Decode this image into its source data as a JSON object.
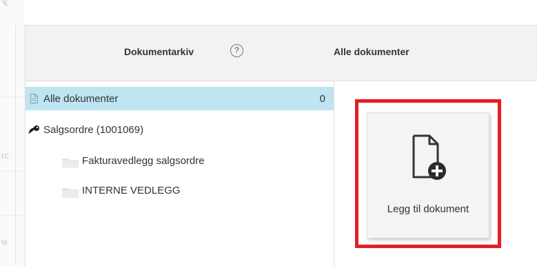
{
  "background": {
    "ghost_glyphs": [
      "'€",
      "rc",
      "te"
    ]
  },
  "header": {
    "title": "Dokumentarkiv",
    "help_glyph": "?",
    "right_title": "Alle dokumenter"
  },
  "sidebar": {
    "items": [
      {
        "label": "Alle dokumenter",
        "count": "0",
        "icon": "document-icon",
        "selected": true
      },
      {
        "label": "Salgsordre (1001069)",
        "icon": "key-icon",
        "selected": false
      },
      {
        "label": "Fakturavedlegg salgsordre",
        "icon": "folder-icon",
        "selected": false
      },
      {
        "label": "INTERNE VEDLEGG",
        "icon": "folder-icon",
        "selected": false
      }
    ]
  },
  "main": {
    "add_document": {
      "label": "Legg til dokument",
      "icon": "add-document-icon"
    }
  },
  "colors": {
    "selected_row": "#bfe5f3",
    "highlight_border": "#e31e24",
    "header_bg": "#f2f2f2"
  }
}
